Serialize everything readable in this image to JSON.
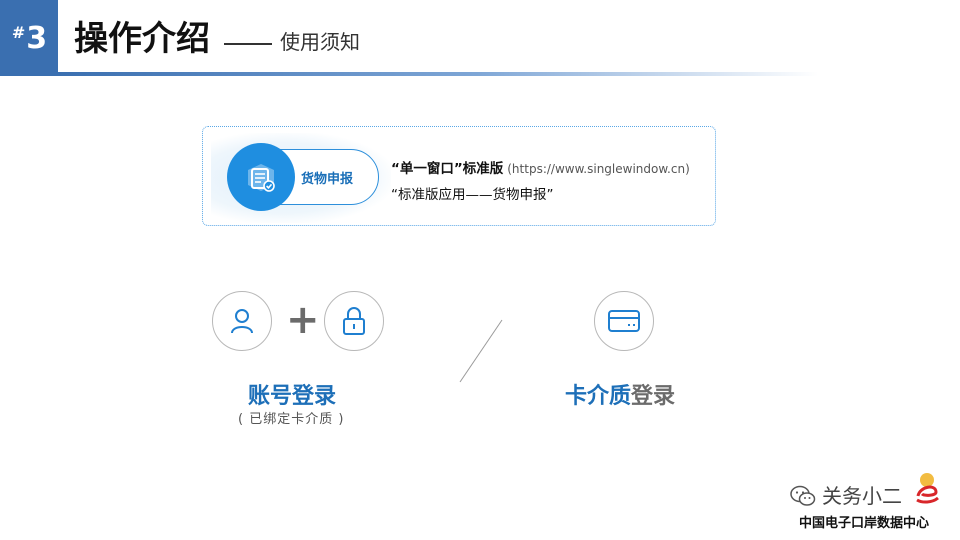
{
  "header": {
    "badge_hash": "#",
    "badge_number": "3",
    "title": "操作介绍",
    "subtitle": "使用须知"
  },
  "info_card": {
    "pill_label": "货物申报",
    "line1_name": "“单一窗口”标准版",
    "line1_url": "(https://www.singlewindow.cn)",
    "line2": "“标准版应用——货物申报”"
  },
  "login_options": {
    "account": {
      "label": "账号登录",
      "note": "( 已绑定卡介质 )",
      "plus": "+"
    },
    "card": {
      "label_blue": "卡介质",
      "label_gray": "登录"
    }
  },
  "watermark": {
    "name": "关务小二",
    "org": "中国电子口岸数据中心"
  },
  "icons": [
    "user-icon",
    "lock-icon",
    "credit-card-icon",
    "document-box-icon",
    "wechat-icon"
  ],
  "colors": {
    "accent": "#3a6fb0",
    "brand_blue": "#1f8ee0",
    "label_blue": "#1d6fb8",
    "gray": "#6b6b6b"
  }
}
